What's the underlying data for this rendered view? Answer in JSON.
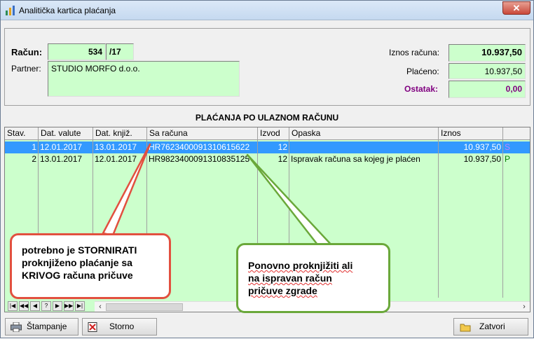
{
  "window": {
    "title": "Analitička kartica plaćanja",
    "close_label": "✕"
  },
  "invoice": {
    "racun_label": "Račun:",
    "racun_number": "534",
    "racun_year": "/17",
    "partner_label": "Partner:",
    "partner_value": "STUDIO MORFO d.o.o.",
    "iznos_label": "Iznos računa:",
    "iznos_value": "10.937,50",
    "placeno_label": "Plaćeno:",
    "placeno_value": "10.937,50",
    "ostatak_label": "Ostatak:",
    "ostatak_value": "0,00",
    "ostatak_color": "#800080"
  },
  "section_title": "PLAĆANJA PO ULAZNOM RAČUNU",
  "grid": {
    "headers": [
      "Stav.",
      "Dat. valute",
      "Dat. knjiž.",
      "Sa računa",
      "Izvod",
      "Opaska",
      "Iznos",
      ""
    ],
    "rows": [
      {
        "stav": "1",
        "dat_valute": "12.01.2017",
        "dat_knjiz": "13.01.2017",
        "sa_racuna": "HR7623400091310615622",
        "izvod": "12",
        "opaska": "",
        "iznos": "10.937,50",
        "flag": "S",
        "selected": true
      },
      {
        "stav": "2",
        "dat_valute": "13.01.2017",
        "dat_knjiz": "12.01.2017",
        "sa_racuna": "HR9823400091310835125",
        "izvod": "12",
        "opaska": "Ispravak računa sa kojeg je plaćen",
        "iznos": "10.937,50",
        "flag": "P",
        "selected": false
      }
    ],
    "nav_buttons": [
      "|◀",
      "◀◀",
      "◀",
      "?",
      "▶",
      "▶▶",
      "▶|"
    ]
  },
  "buttons": {
    "stampanje": "Štampanje",
    "storno": "Storno",
    "zatvori": "Zatvori"
  },
  "callouts": {
    "red_text": [
      "potrebno je STORNIRATI",
      "proknjiženo plaćanje sa",
      "KRIVOG računa pričuve"
    ],
    "green_text": [
      "Ponovno proknjižiti ali",
      "na ispravan  račun",
      "pričuve zgrade"
    ]
  },
  "colors": {
    "field_bg": "#ccffcc",
    "selected_row": "#3399ff",
    "red_callout": "#e2503f",
    "green_callout": "#6aa83a"
  }
}
